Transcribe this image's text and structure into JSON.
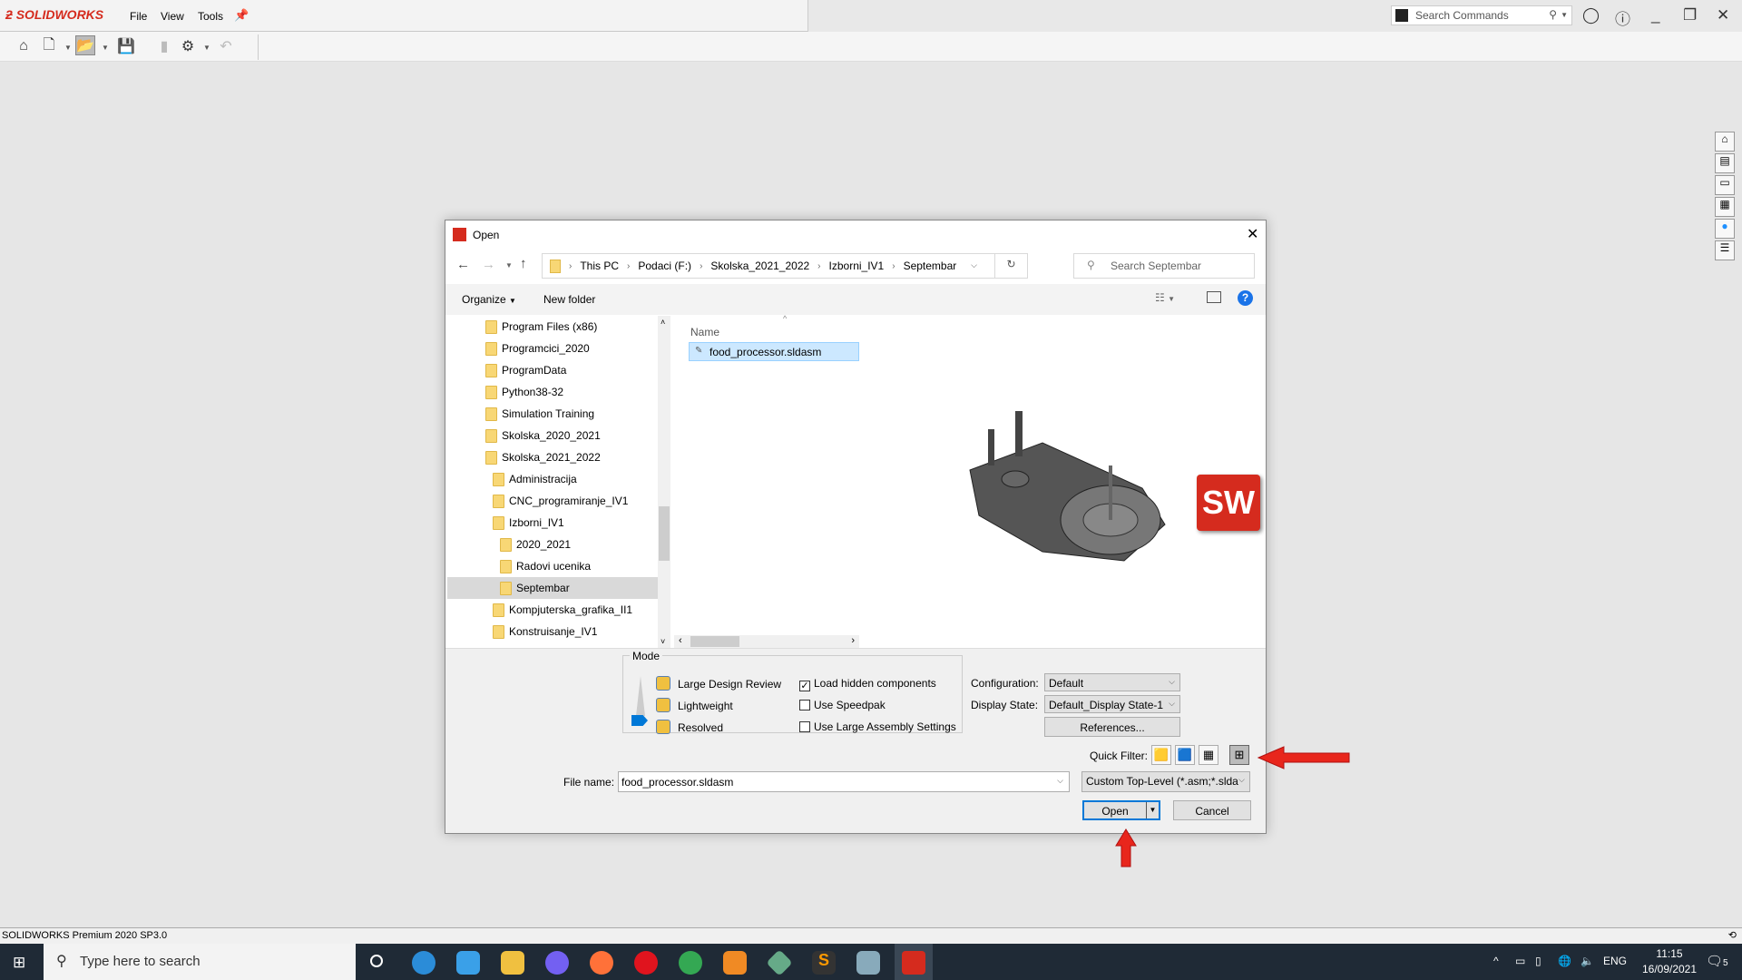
{
  "app": {
    "brand": "SOLIDWORKS",
    "menu": [
      "File",
      "View",
      "Tools"
    ],
    "search_commands": "Search Commands",
    "status": "SOLIDWORKS Premium 2020 SP3.0"
  },
  "dialog": {
    "title": "Open",
    "breadcrumb": [
      "This PC",
      "Podaci (F:)",
      "Skolska_2021_2022",
      "Izborni_IV1",
      "Septembar"
    ],
    "search_placeholder": "Search Septembar",
    "organize": "Organize",
    "new_folder": "New folder",
    "tree": [
      {
        "label": "Program Files (x86)",
        "level": 1
      },
      {
        "label": "Programcici_2020",
        "level": 1
      },
      {
        "label": "ProgramData",
        "level": 1
      },
      {
        "label": "Python38-32",
        "level": 1
      },
      {
        "label": "Simulation Training",
        "level": 1
      },
      {
        "label": "Skolska_2020_2021",
        "level": 1
      },
      {
        "label": "Skolska_2021_2022",
        "level": 1
      },
      {
        "label": "Administracija",
        "level": 2
      },
      {
        "label": "CNC_programiranje_IV1",
        "level": 2
      },
      {
        "label": "Izborni_IV1",
        "level": 2
      },
      {
        "label": "2020_2021",
        "level": 3
      },
      {
        "label": "Radovi ucenika",
        "level": 3
      },
      {
        "label": "Septembar",
        "level": 3,
        "selected": true
      },
      {
        "label": "Kompjuterska_grafika_II1",
        "level": 2
      },
      {
        "label": "Konstruisanje_IV1",
        "level": 2
      }
    ],
    "column_name": "Name",
    "files": [
      "food_processor.sldasm"
    ],
    "mode": {
      "title": "Mode",
      "options": [
        "Large Design Review",
        "Lightweight",
        "Resolved"
      ],
      "selected": "Resolved"
    },
    "checkboxes": [
      {
        "label": "Load hidden components",
        "checked": true
      },
      {
        "label": "Use Speedpak",
        "checked": false
      },
      {
        "label": "Use Large Assembly Settings",
        "checked": false
      }
    ],
    "configuration": {
      "label": "Configuration:",
      "value": "Default"
    },
    "display_state": {
      "label": "Display State:",
      "value": "Default_Display State-1"
    },
    "references": "References...",
    "quick_filter": "Quick Filter:",
    "file_name_label": "File name:",
    "file_name": "food_processor.sldasm",
    "file_type": "Custom Top-Level (*.asm;*.slda",
    "open": "Open",
    "cancel": "Cancel"
  },
  "taskbar": {
    "search": "Type here to search",
    "lang": "ENG",
    "time": "11:15",
    "date": "16/09/2021",
    "notifications": "5"
  },
  "colors": {
    "accent": "#0078d7",
    "annotation_arrow": "#e8261c",
    "brand_red": "#d52b1e"
  }
}
